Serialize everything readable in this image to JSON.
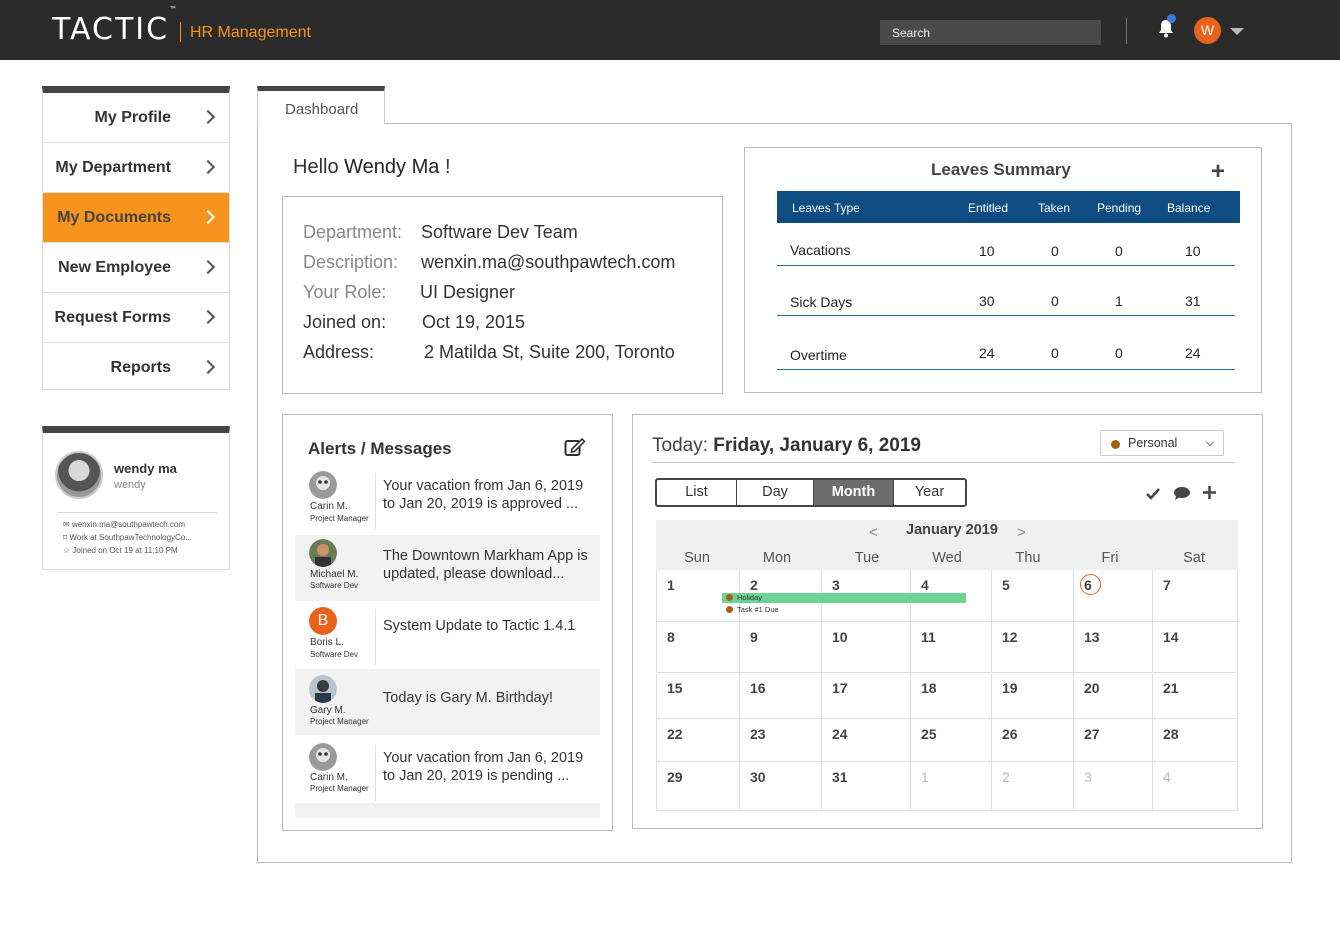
{
  "app": {
    "logo": "TACTIC",
    "logo_tm": "™",
    "name": "HR Management"
  },
  "header": {
    "search_placeholder": "Search",
    "avatar_initial": "W"
  },
  "sidebar": {
    "items": [
      {
        "label": "My Profile"
      },
      {
        "label": "My Department"
      },
      {
        "label": "My Documents"
      },
      {
        "label": "New Employee"
      },
      {
        "label": "Request Forms"
      },
      {
        "label": "Reports"
      }
    ],
    "active_index": 2
  },
  "profile_card": {
    "name": "wendy ma",
    "username": "wendy",
    "email": "wenxin.ma@southpawtech.com",
    "work": "Work at SouthpawTechnologyCo...",
    "joined": "Joined on Oct 19 at 11:10 PM"
  },
  "tabs": {
    "dashboard": "Dashboard"
  },
  "greeting": {
    "prefix": "Hello",
    "name": "Wendy Ma",
    "suffix": "!"
  },
  "info": {
    "department_label": "Department:",
    "department": "Software Dev Team",
    "description_label": "Description:",
    "description": "wenxin.ma@southpawtech.com",
    "role_label": "Your Role:",
    "role": "UI Designer",
    "joined_label": "Joined on:",
    "joined": "Oct 19, 2015",
    "address_label": "Address:",
    "address": "2 Matilda St, Suite 200, Toronto"
  },
  "leaves": {
    "title": "Leaves Summary",
    "add": "+",
    "columns": [
      "Leaves Type",
      "Entitled",
      "Taken",
      "Pending",
      "Balance"
    ],
    "rows": [
      {
        "type": "Vacations",
        "entitled": "10",
        "taken": "0",
        "pending": "0",
        "balance": "10"
      },
      {
        "type": "Sick Days",
        "entitled": "30",
        "taken": "0",
        "pending": "1",
        "balance": "31"
      },
      {
        "type": "Overtime",
        "entitled": "24",
        "taken": "0",
        "pending": "0",
        "balance": "24"
      }
    ]
  },
  "alerts": {
    "title": "Alerts / Messages",
    "items": [
      {
        "name": "Carin M.",
        "role": "Project Manager",
        "text": "Your vacation from Jan 6, 2019 to Jan 20, 2019 is approved ..."
      },
      {
        "name": "Michael M.",
        "role": "Software Dev",
        "text": "The Downtown Markham App is updated, please download..."
      },
      {
        "name": "Boris L.",
        "role": "Software Dev",
        "text": "System Update to Tactic 1.4.1",
        "initial": "B"
      },
      {
        "name": "Gary M.",
        "role": "Project Manager",
        "text": "Today is Gary M. Birthday!"
      },
      {
        "name": "Carin M.",
        "role": "Project Manager",
        "text": "Your vacation from Jan 6, 2019 to Jan 20, 2019 is pending ..."
      }
    ]
  },
  "calendar": {
    "today_label": "Today:",
    "today_date": "Friday, January 6, 2019",
    "filter": "Personal",
    "views": [
      "List",
      "Day",
      "Month",
      "Year"
    ],
    "active_view": "Month",
    "month": "January 2019",
    "prev": "<",
    "next": ">",
    "days_of_week": [
      "Sun",
      "Mon",
      "Tue",
      "Wed",
      "Thu",
      "Fri",
      "Sat"
    ],
    "weeks": [
      [
        "1",
        "2",
        "3",
        "4",
        "5",
        "6",
        "7"
      ],
      [
        "8",
        "9",
        "10",
        "11",
        "12",
        "13",
        "14"
      ],
      [
        "15",
        "16",
        "17",
        "18",
        "19",
        "20",
        "21"
      ],
      [
        "22",
        "23",
        "24",
        "25",
        "26",
        "27",
        "28"
      ],
      [
        "29",
        "30",
        "31",
        "1",
        "2",
        "3",
        "4"
      ]
    ],
    "events": [
      {
        "label": "Holiday",
        "color": "#6cd596"
      },
      {
        "label": "Task #1 Due"
      }
    ],
    "accent_color": "#e8621c"
  },
  "colors": {
    "brand_orange": "#f7941d",
    "header_blue": "#0f4c81",
    "topbar": "#2b2b2b"
  }
}
